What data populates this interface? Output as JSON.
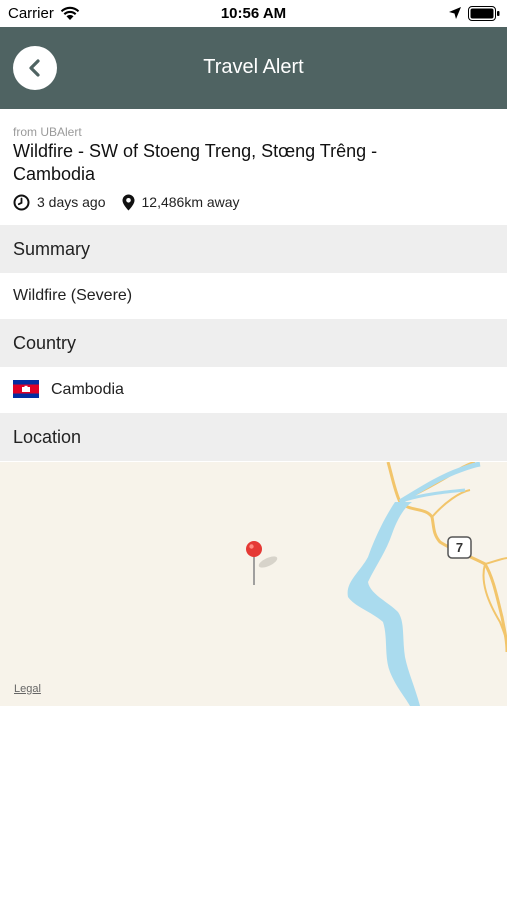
{
  "status_bar": {
    "carrier": "Carrier",
    "time": "10:56 AM"
  },
  "nav": {
    "title": "Travel Alert",
    "back_icon": "chevron-left-icon"
  },
  "alert": {
    "source": "from UBAlert",
    "title": "Wildfire - SW of Stoeng Treng, Stœng Trêng - Cambodia",
    "time_ago": "3 days ago",
    "distance": "12,486km away"
  },
  "sections": {
    "summary_label": "Summary",
    "summary_value": "Wildfire (Severe)",
    "country_label": "Country",
    "country_value": "Cambodia",
    "location_label": "Location"
  },
  "map": {
    "road_number": "7",
    "legal_label": "Legal"
  },
  "colors": {
    "nav_bg": "#4f6362",
    "section_bg": "#eeeeee",
    "map_bg": "#f7f3ea",
    "river": "#aadbee",
    "road": "#f2c56b",
    "pin": "#e53935"
  }
}
